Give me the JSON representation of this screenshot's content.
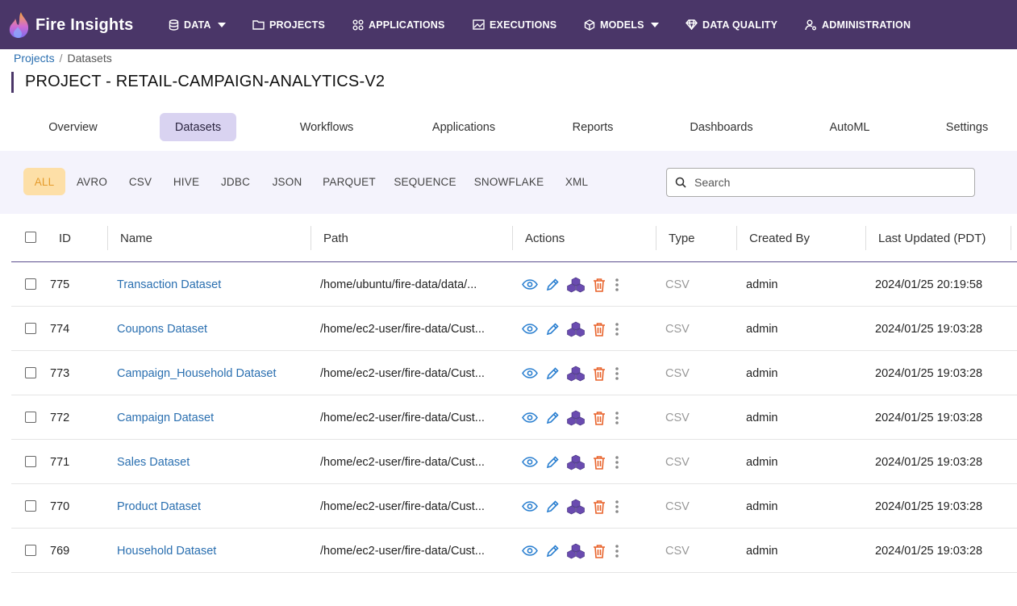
{
  "app": {
    "brand": "Fire Insights"
  },
  "nav": [
    {
      "label": "DATA",
      "icon": "database-icon",
      "caret": true
    },
    {
      "label": "PROJECTS",
      "icon": "folder-icon",
      "caret": false
    },
    {
      "label": "APPLICATIONS",
      "icon": "apps-grid-icon",
      "caret": false
    },
    {
      "label": "EXECUTIONS",
      "icon": "chart-image-icon",
      "caret": false
    },
    {
      "label": "MODELS",
      "icon": "cube-icon",
      "caret": true
    },
    {
      "label": "DATA QUALITY",
      "icon": "diamond-icon",
      "caret": false
    },
    {
      "label": "ADMINISTRATION",
      "icon": "user-gear-icon",
      "caret": false
    }
  ],
  "breadcrumb": {
    "root": "Projects",
    "separator": "/",
    "current": "Datasets"
  },
  "page_title": "PROJECT - RETAIL-CAMPAIGN-ANALYTICS-V2",
  "tabs": [
    "Overview",
    "Datasets",
    "Workflows",
    "Applications",
    "Reports",
    "Dashboards",
    "AutoML",
    "Settings"
  ],
  "active_tab": "Datasets",
  "filters": [
    "ALL",
    "AVRO",
    "CSV",
    "HIVE",
    "JDBC",
    "JSON",
    "PARQUET",
    "SEQUENCE",
    "SNOWFLAKE",
    "XML"
  ],
  "active_filter": "ALL",
  "search": {
    "placeholder": "Search",
    "value": ""
  },
  "table": {
    "columns": [
      "ID",
      "Name",
      "Path",
      "Actions",
      "Type",
      "Created By",
      "Last Updated (PDT)"
    ],
    "rows": [
      {
        "id": "775",
        "name": "Transaction Dataset",
        "path": "/home/ubuntu/fire-data/data/...",
        "type": "CSV",
        "created_by": "admin",
        "updated": "2024/01/25 20:19:58"
      },
      {
        "id": "774",
        "name": "Coupons Dataset",
        "path": "/home/ec2-user/fire-data/Cust...",
        "type": "CSV",
        "created_by": "admin",
        "updated": "2024/01/25 19:03:28"
      },
      {
        "id": "773",
        "name": "Campaign_Household Dataset",
        "path": "/home/ec2-user/fire-data/Cust...",
        "type": "CSV",
        "created_by": "admin",
        "updated": "2024/01/25 19:03:28"
      },
      {
        "id": "772",
        "name": "Campaign Dataset",
        "path": "/home/ec2-user/fire-data/Cust...",
        "type": "CSV",
        "created_by": "admin",
        "updated": "2024/01/25 19:03:28"
      },
      {
        "id": "771",
        "name": "Sales Dataset",
        "path": "/home/ec2-user/fire-data/Cust...",
        "type": "CSV",
        "created_by": "admin",
        "updated": "2024/01/25 19:03:28"
      },
      {
        "id": "770",
        "name": "Product Dataset",
        "path": "/home/ec2-user/fire-data/Cust...",
        "type": "CSV",
        "created_by": "admin",
        "updated": "2024/01/25 19:03:28"
      },
      {
        "id": "769",
        "name": "Household Dataset",
        "path": "/home/ec2-user/fire-data/Cust...",
        "type": "CSV",
        "created_by": "admin",
        "updated": "2024/01/25 19:03:28"
      }
    ],
    "row_actions": [
      "view-eye-icon",
      "edit-pencil-icon",
      "cubes-icon",
      "delete-trash-icon",
      "more-vertical-icon"
    ]
  },
  "colors": {
    "nav_bg": "#4a3668",
    "link": "#2a6fb0",
    "tab_active_bg": "#d9d3f1",
    "chip_active_bg": "#fddfa7",
    "chip_active_text": "#e59b2c",
    "delete": "#e8622a",
    "cubes": "#6a4bb0"
  }
}
